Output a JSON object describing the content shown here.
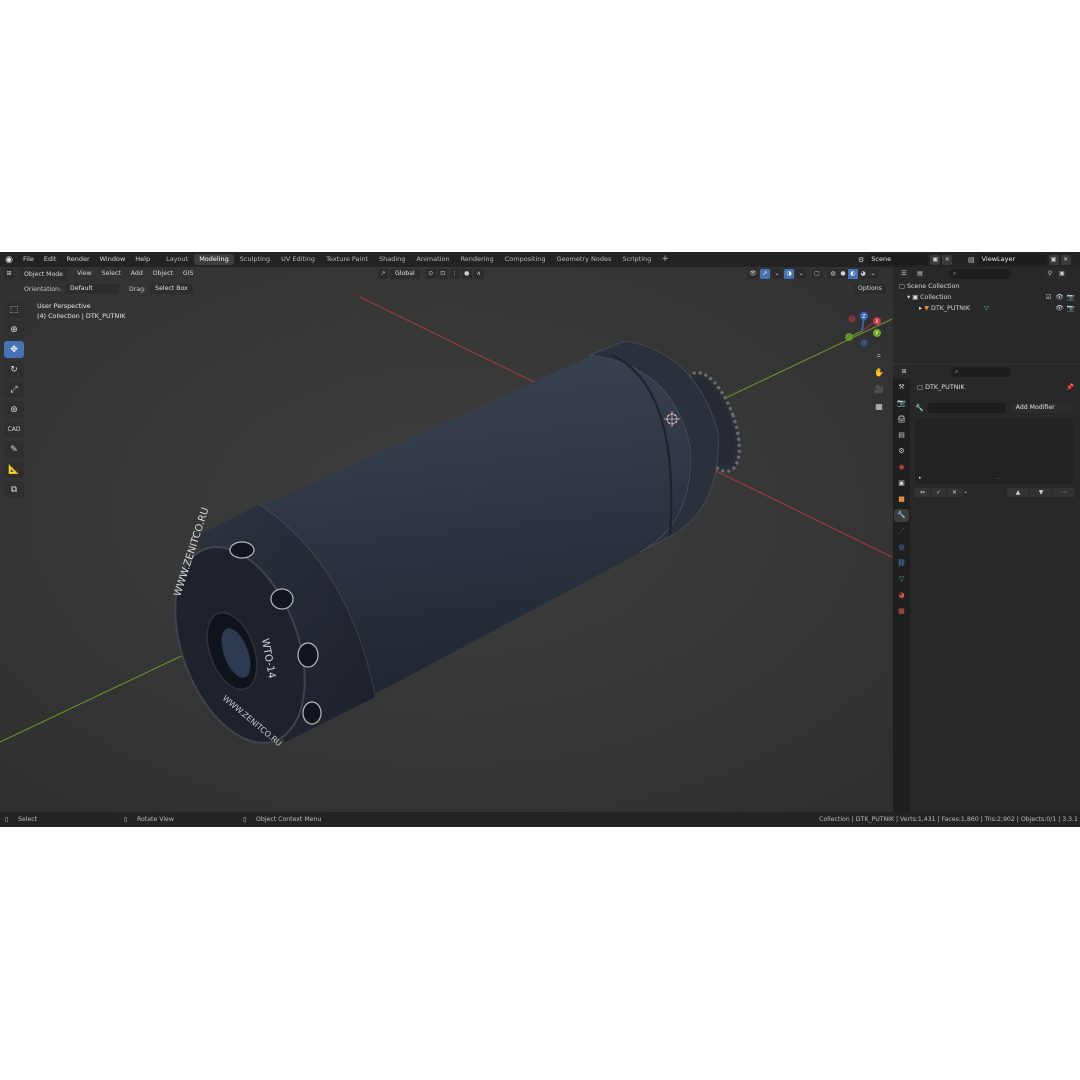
{
  "topbar": {
    "menus": [
      "File",
      "Edit",
      "Render",
      "Window",
      "Help"
    ],
    "workspaces": [
      "Layout",
      "Modeling",
      "Sculpting",
      "UV Editing",
      "Texture Paint",
      "Shading",
      "Animation",
      "Rendering",
      "Compositing",
      "Geometry Nodes",
      "Scripting"
    ],
    "active_workspace": "Modeling",
    "add_tab": "+",
    "scene": "Scene",
    "view_layer": "ViewLayer"
  },
  "viewport_header": {
    "mode": "Object Mode",
    "menus": [
      "View",
      "Select",
      "Add",
      "Object",
      "GIS"
    ],
    "transform_orientation": "Global",
    "orientation_label": "Orientation:",
    "orientation_value": "Default",
    "drag_label": "Drag:",
    "drag_value": "Select Box",
    "options": "Options"
  },
  "viewport_info": {
    "line1": "User Perspective",
    "line2": "(4) Collection | DTK_PUTNIK"
  },
  "tools": [
    "select-box",
    "cursor",
    "move",
    "rotate",
    "scale",
    "transform",
    "CAD",
    "annotate",
    "measure",
    "add-cube"
  ],
  "cad_label": "CAD",
  "model_text": {
    "ring1": "WWW.ZENITCO.RU",
    "ring2": "WTO-14",
    "ring3": "WWW.ZENITCO.RU"
  },
  "outliner": {
    "scene_collection": "Scene Collection",
    "collection": "Collection",
    "object": "DTK_PUTNIK"
  },
  "properties": {
    "object_name": "DTK_PUTNIK",
    "add_modifier": "Add Modifier"
  },
  "statusbar": {
    "select": "Select",
    "rotate": "Rotate View",
    "context": "Object Context Menu",
    "stats": "Collection | DTK_PUTNIK | Verts:1,431 | Faces:1,860 | Tris:2,902 | Objects:0/1 | 3.3.1"
  },
  "colors": {
    "accent": "#4772b3",
    "x_axis": "#a83a45",
    "y_axis": "#6f9a2a"
  }
}
